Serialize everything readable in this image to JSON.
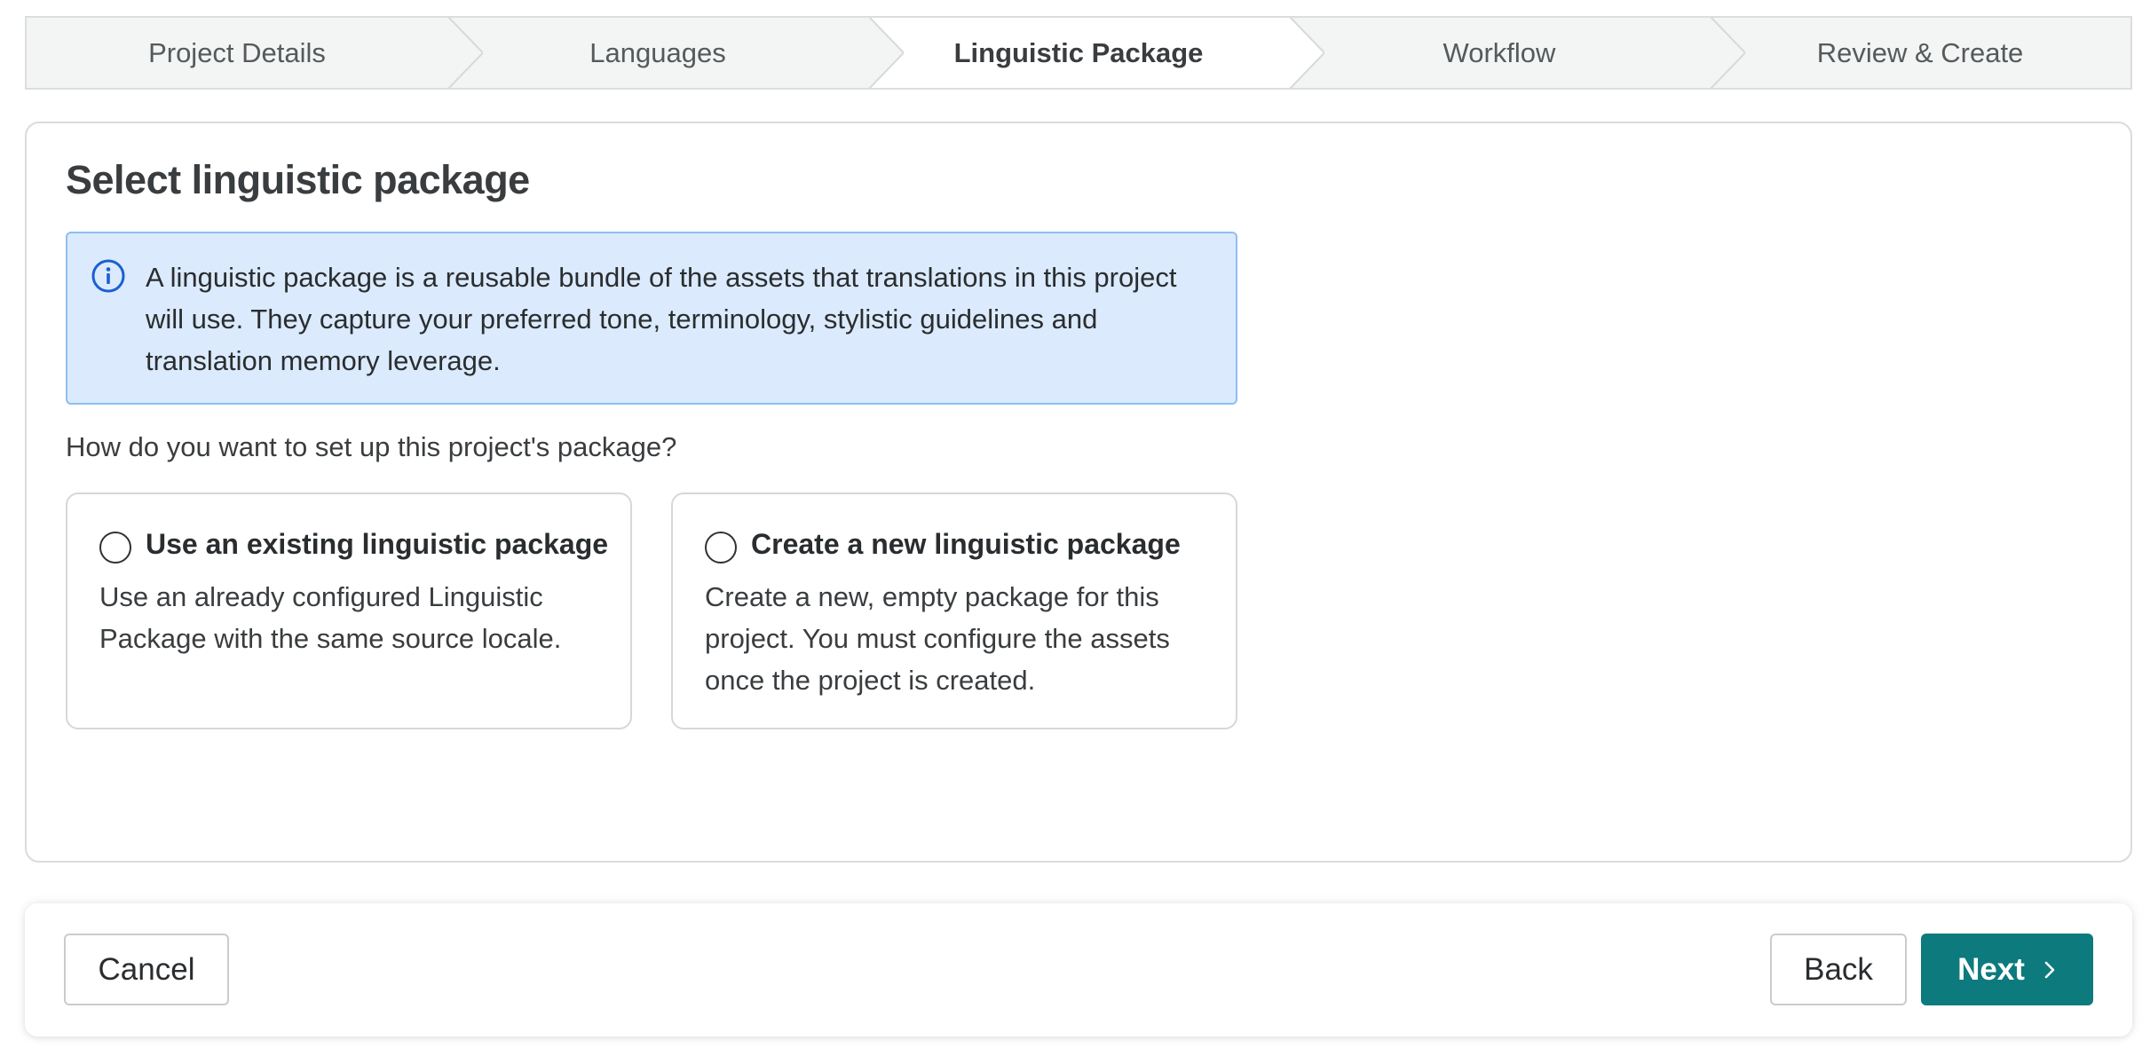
{
  "stepper": {
    "steps": [
      {
        "label": "Project Details"
      },
      {
        "label": "Languages"
      },
      {
        "label": "Linguistic Package",
        "active": true
      },
      {
        "label": "Workflow"
      },
      {
        "label": "Review & Create"
      }
    ]
  },
  "main": {
    "title": "Select linguistic package",
    "info": {
      "icon": "info-circle-icon",
      "text": "A linguistic package is a reusable bundle of the assets that translations in this project will use. They capture your preferred tone, terminology, stylistic guidelines and translation memory leverage."
    },
    "question": "How do you want to set up this project's package?",
    "options": [
      {
        "label": "Use an existing linguistic package",
        "description": "Use an already configured Linguistic Package with the same source locale.",
        "selected": false
      },
      {
        "label": "Create a new linguistic package",
        "description": "Create a new, empty package for this project. You must configure the assets once the project is created.",
        "selected": false
      }
    ]
  },
  "footer": {
    "cancel_label": "Cancel",
    "back_label": "Back",
    "next_label": "Next",
    "next_icon": "chevron-right-icon"
  },
  "colors": {
    "accent": "#0d7a7d",
    "info_bg": "#dbeafd",
    "info_border": "#8fbef3",
    "info_icon": "#1b5fd1",
    "stepper_bg": "#f3f4f4",
    "stepper_active_bg": "#ffffff"
  }
}
